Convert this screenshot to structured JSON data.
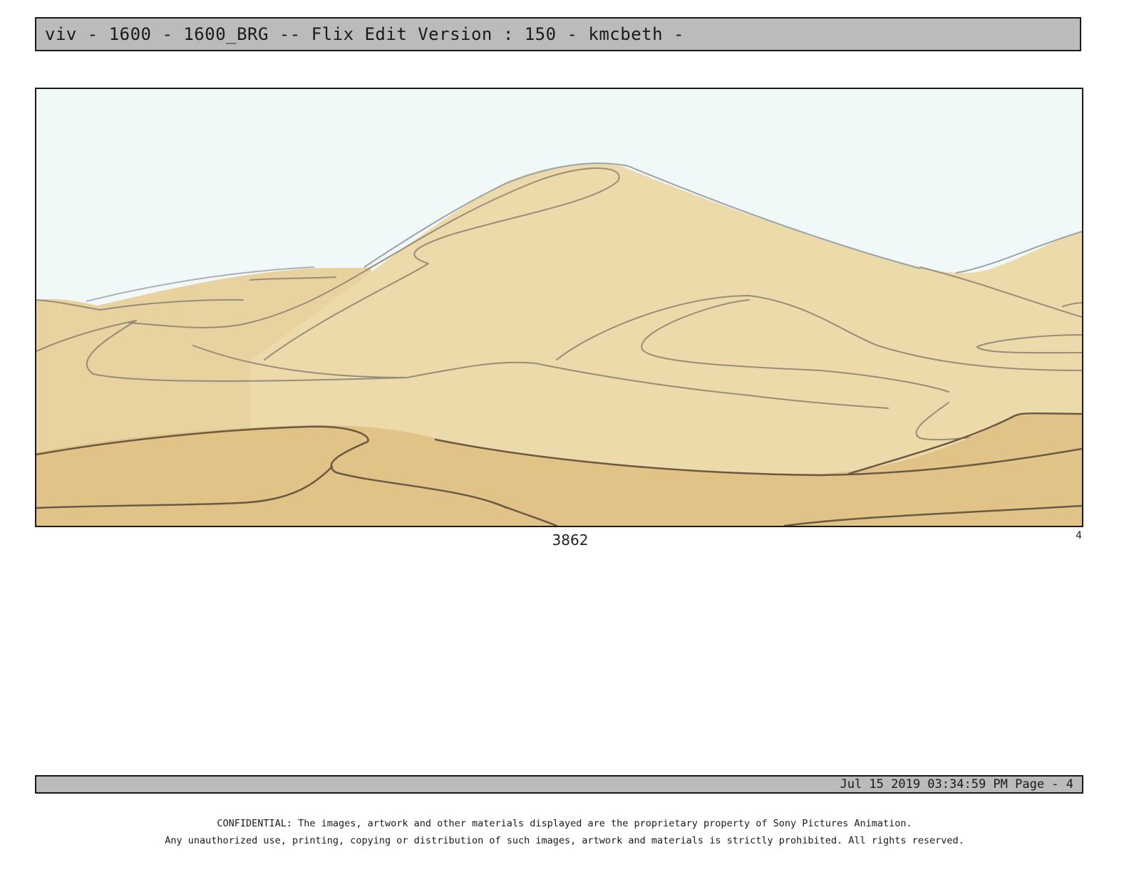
{
  "header": {
    "title": "viv - 1600 - 1600_BRG -- Flix Edit Version : 150 - kmcbeth -"
  },
  "panel": {
    "number": "3862",
    "index": "4",
    "artwork": "desert-dunes-sketch"
  },
  "footer": {
    "timestamp_page": "Jul 15 2019 03:34:59 PM Page - 4"
  },
  "confidential": {
    "line1": "CONFIDENTIAL: The images, artwork and other materials displayed are the proprietary property of Sony Pictures Animation.",
    "line2": "Any unauthorized use, printing, copying or distribution of such images, artwork and materials is strictly prohibited. All rights reserved."
  },
  "colors": {
    "bar": "#bbbbbb",
    "sky": "#f0f8f8",
    "dune_light": "#ecdaab",
    "dune_mid": "#e8d3a0",
    "dune_dark": "#e2c387",
    "line": "#7a6e5e"
  }
}
